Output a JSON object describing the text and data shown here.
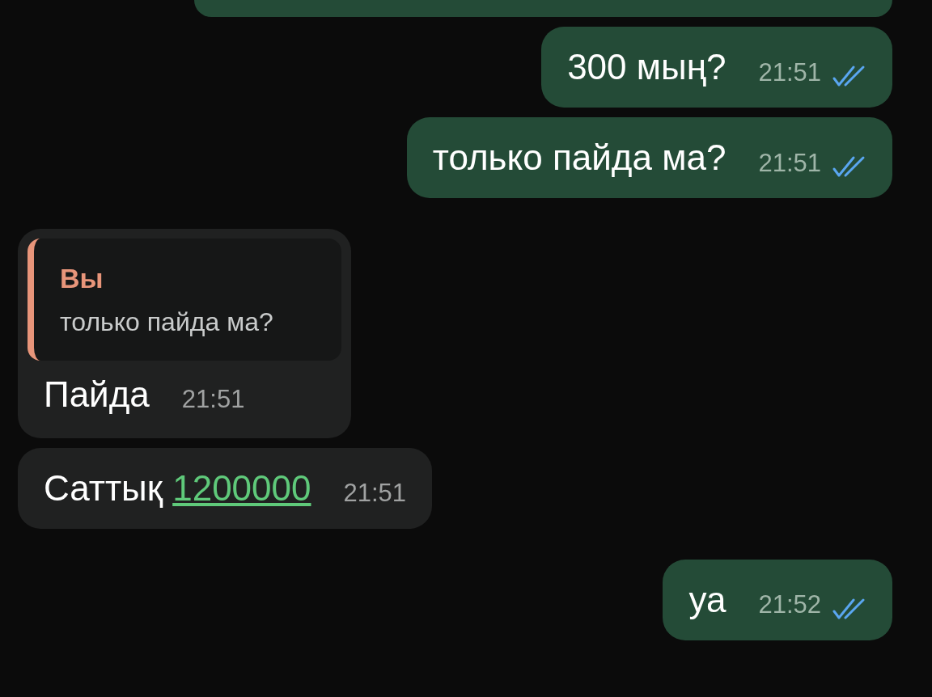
{
  "messages": [
    {
      "kind": "outgoing",
      "read": true,
      "text": "300 мың?",
      "time": "21:51"
    },
    {
      "kind": "outgoing",
      "read": true,
      "text": "только пайда ма?",
      "time": "21:51"
    },
    {
      "kind": "incoming",
      "reply": {
        "author": "Вы",
        "text": "только пайда ма?"
      },
      "text": "Пайда",
      "time": "21:51"
    },
    {
      "kind": "incoming",
      "text": "Саттық",
      "link": "1200000",
      "time": "21:51"
    },
    {
      "kind": "outgoing",
      "read": true,
      "text": "уа",
      "time": "21:52"
    }
  ]
}
